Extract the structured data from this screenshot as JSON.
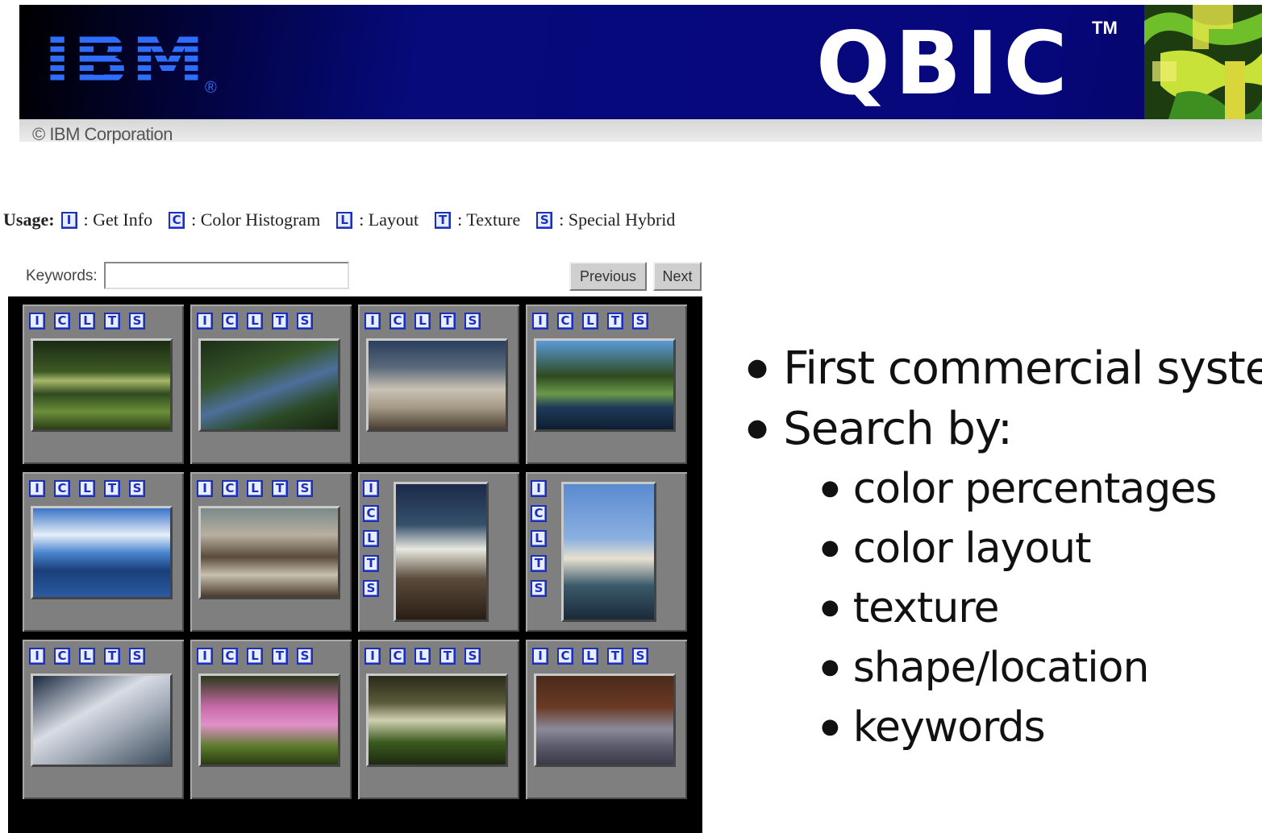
{
  "banner": {
    "ibm_logo": "IBM",
    "ibm_registered": "®",
    "product_logo": "QBIC",
    "trademark": "TM",
    "copyright": "© IBM Corporation"
  },
  "usage": {
    "label": "Usage:",
    "items": [
      {
        "letter": "I",
        "text": ": Get Info"
      },
      {
        "letter": "C",
        "text": ": Color Histogram"
      },
      {
        "letter": "L",
        "text": ": Layout"
      },
      {
        "letter": "T",
        "text": ": Texture"
      },
      {
        "letter": "S",
        "text": ": Special Hybrid"
      }
    ]
  },
  "search": {
    "keywords_label": "Keywords:",
    "keywords_value": "",
    "previous_label": "Previous",
    "next_label": "Next"
  },
  "query_letters": [
    "I",
    "C",
    "L",
    "T",
    "S"
  ],
  "results": [
    {
      "thumb": "park-trees",
      "orientation": "landscape"
    },
    {
      "thumb": "forest-stream",
      "orientation": "landscape"
    },
    {
      "thumb": "hikers-rock",
      "orientation": "landscape"
    },
    {
      "thumb": "pond-trees",
      "orientation": "landscape"
    },
    {
      "thumb": "lake-clouds",
      "orientation": "landscape"
    },
    {
      "thumb": "mountain-road",
      "orientation": "landscape"
    },
    {
      "thumb": "canyon-cloud",
      "orientation": "portrait"
    },
    {
      "thumb": "lake-fountain",
      "orientation": "portrait"
    },
    {
      "thumb": "snowy-rock",
      "orientation": "landscape"
    },
    {
      "thumb": "pink-blossoms",
      "orientation": "landscape"
    },
    {
      "thumb": "forest-clearing",
      "orientation": "landscape"
    },
    {
      "thumb": "marching-band",
      "orientation": "landscape"
    }
  ],
  "bullets": [
    {
      "level": 1,
      "text": "First commercial syste"
    },
    {
      "level": 1,
      "text": "Search by:"
    },
    {
      "level": 2,
      "text": "color percentages"
    },
    {
      "level": 2,
      "text": "color layout"
    },
    {
      "level": 2,
      "text": "texture"
    },
    {
      "level": 2,
      "text": "shape/location"
    },
    {
      "level": 2,
      "text": "keywords"
    }
  ],
  "colors": {
    "banner_blue": "#06077c",
    "ibm_blue": "#2f6dff",
    "button_blue": "#1c2fb8",
    "grid_bg": "#000000",
    "cell_gray": "#7f7f7f"
  }
}
